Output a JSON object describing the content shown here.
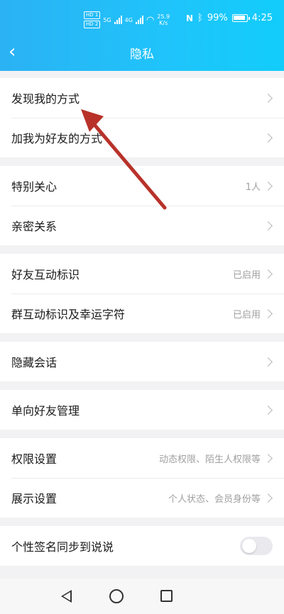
{
  "status_bar": {
    "sim1": "HD 1",
    "sim2": "HD 2",
    "net1": "5G",
    "net2": "4G",
    "speed_value": "25.9",
    "speed_unit": "K/s",
    "battery": "99%",
    "time": "4:25"
  },
  "header": {
    "title": "隐私"
  },
  "groups": [
    {
      "rows": [
        {
          "label": "发现我的方式",
          "value": ""
        },
        {
          "label": "加我为好友的方式",
          "value": ""
        }
      ]
    },
    {
      "rows": [
        {
          "label": "特别关心",
          "value": "1人"
        },
        {
          "label": "亲密关系",
          "value": ""
        }
      ]
    },
    {
      "rows": [
        {
          "label": "好友互动标识",
          "value": "已启用"
        },
        {
          "label": "群互动标识及幸运字符",
          "value": "已启用"
        }
      ]
    },
    {
      "rows": [
        {
          "label": "隐藏会话",
          "value": ""
        }
      ]
    },
    {
      "rows": [
        {
          "label": "单向好友管理",
          "value": ""
        }
      ]
    },
    {
      "rows": [
        {
          "label": "权限设置",
          "value": "动态权限、陌生人权限等"
        },
        {
          "label": "展示设置",
          "value": "个人状态、会员身份等"
        }
      ]
    },
    {
      "rows": [
        {
          "label": "个性签名同步到说说",
          "toggle_on": false
        }
      ]
    }
  ],
  "colors": {
    "header_start": "#2bb2f4",
    "header_end": "#12cdfb",
    "annotation_arrow": "#b8322a"
  }
}
